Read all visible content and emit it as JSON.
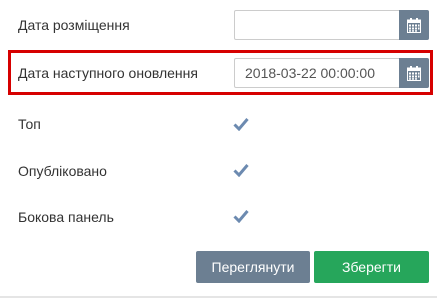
{
  "form": {
    "placement_date": {
      "label": "Дата розміщення",
      "value": "",
      "icon": "calendar-icon"
    },
    "next_update_date": {
      "label": "Дата наступного оновлення",
      "value": "2018-03-22 00:00:00",
      "icon": "calendar-icon"
    },
    "top": {
      "label": "Топ",
      "checked": true
    },
    "published": {
      "label": "Опубліковано",
      "checked": true
    },
    "sidebar": {
      "label": "Бокова панель",
      "checked": true
    }
  },
  "buttons": {
    "preview_label": "Переглянути",
    "save_label": "Зберегти"
  },
  "colors": {
    "calendar_button": "#6c7f92",
    "preview_button": "#6c7f92",
    "save_button": "#26a65b",
    "highlight": "#d60000",
    "checkmark": "#6c8ab0"
  }
}
